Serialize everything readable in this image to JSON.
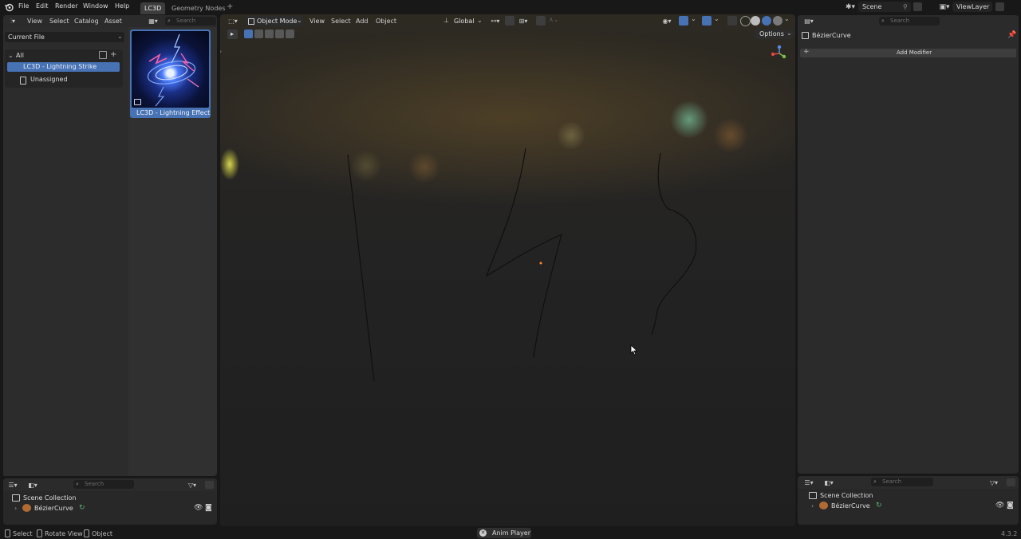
{
  "topbar": {
    "menus": [
      "File",
      "Edit",
      "Render",
      "Window",
      "Help"
    ],
    "workspace_tabs": [
      "LC3D",
      "Geometry Nodes"
    ],
    "add_tab": "+",
    "scene": "Scene",
    "view_layer": "ViewLayer"
  },
  "asset_browser": {
    "menus": [
      "View",
      "Select",
      "Catalog",
      "Asset"
    ],
    "search_placeholder": "Search",
    "library": "Current File",
    "tree": {
      "root": "All",
      "selected": "LC3D - Lightning Strike",
      "unassigned": "Unassigned"
    },
    "asset_name": "LC3D - Lightning Effect"
  },
  "viewport": {
    "mode": "Object Mode",
    "menus": [
      "View",
      "Select",
      "Add",
      "Object"
    ],
    "transform_orientation": "Global",
    "options_label": "Options"
  },
  "properties": {
    "search_placeholder": "Search",
    "object_name": "BézierCurve",
    "add_modifier": "Add Modifier"
  },
  "outliner_left": {
    "search_placeholder": "Search",
    "collection": "Scene Collection",
    "object": "BézierCurve"
  },
  "outliner_right": {
    "search_placeholder": "Search",
    "collection": "Scene Collection",
    "object": "BézierCurve"
  },
  "statusbar": {
    "select": "Select",
    "rotate_view": "Rotate View",
    "object": "Object",
    "anim_player": "Anim Player",
    "version": "4.3.2"
  },
  "colors": {
    "accent": "#4772b3",
    "active_tab": "#3d3d3d",
    "panel": "#303030",
    "header": "#2b2b2b"
  },
  "icons": [
    "blender-logo-icon",
    "editor-type-icon",
    "search-icon",
    "eye-icon",
    "camera-icon",
    "filter-icon",
    "pin-icon",
    "wrench-icon",
    "close-icon"
  ]
}
